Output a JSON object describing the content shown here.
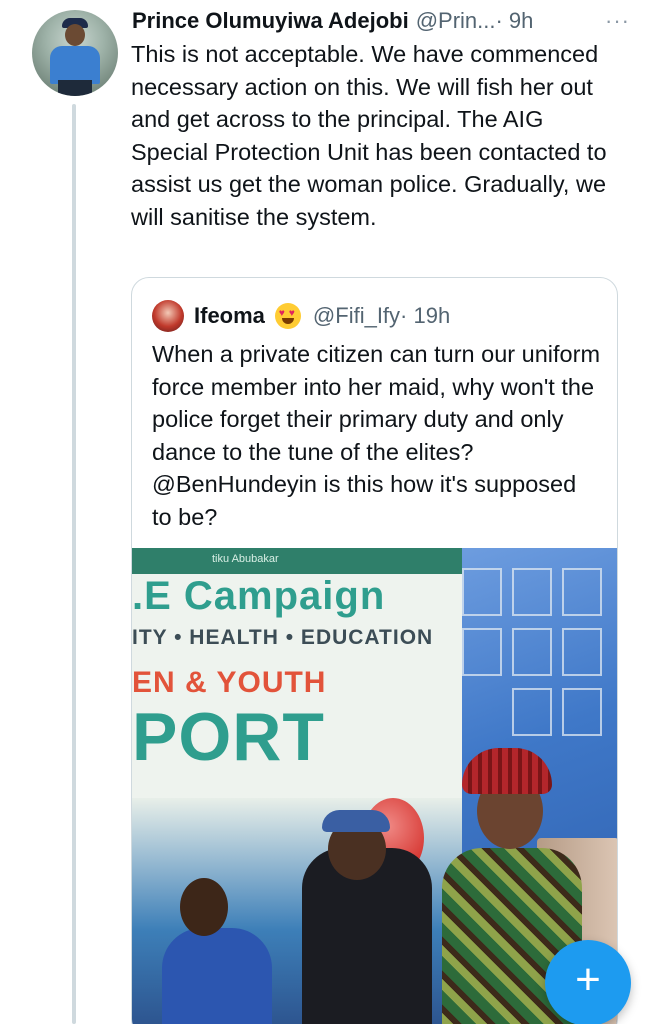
{
  "tweet": {
    "author_name": "Prince Olumuyiwa Adejobi",
    "author_handle": "@Prin...",
    "time": " · 9h",
    "more_label": "···",
    "text": "This is not acceptable. We have commenced necessary action on this. We will fish her out and get across to the principal. The AIG Special Protection Unit has been contacted to assist us get the woman police. Gradually, we will sanitise the system."
  },
  "quoted_tweet": {
    "author_name": "Ifeoma",
    "author_emoji": "heart-eyes-emoji",
    "author_handle": "@Fifi_Ify",
    "time": " · 19h",
    "text": "When a private citizen can turn our uniform force member into her maid, why won't the police forget their primary duty and only dance to the tune of the elites? @BenHundeyin is this how it's supposed to be?",
    "photo_banner": {
      "top_text": "tiku Abubakar",
      "line1": ".E Campaign",
      "line2": "ITY • HEALTH • EDUCATION",
      "line3": "EN & YOUTH",
      "line4": "PORT"
    }
  },
  "fab": {
    "label": "+",
    "icon": "compose-plus-icon",
    "color": "#1d9bf0"
  },
  "colors": {
    "text": "#0f1419",
    "secondary": "#536471",
    "border": "#cfd9de",
    "accent": "#1d9bf0"
  }
}
